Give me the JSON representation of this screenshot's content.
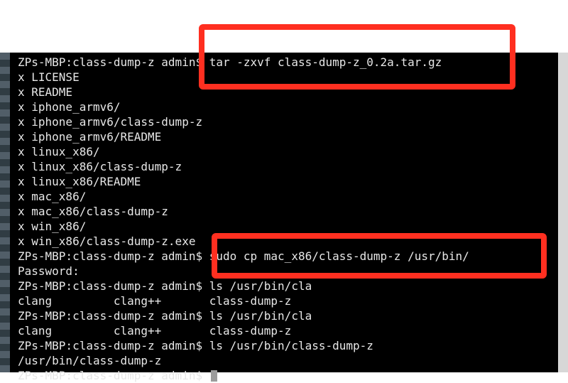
{
  "terminal": {
    "lines": [
      "ZPs-MBP:class-dump-z admin$ tar -zxvf class-dump-z_0.2a.tar.gz",
      "x LICENSE",
      "x README",
      "x iphone_armv6/",
      "x iphone_armv6/class-dump-z",
      "x iphone_armv6/README",
      "x linux_x86/",
      "x linux_x86/class-dump-z",
      "x linux_x86/README",
      "x mac_x86/",
      "x mac_x86/class-dump-z",
      "x win_x86/",
      "x win_x86/class-dump-z.exe",
      "ZPs-MBP:class-dump-z admin$ sudo cp mac_x86/class-dump-z /usr/bin/",
      "Password:",
      "ZPs-MBP:class-dump-z admin$ ls /usr/bin/cla",
      "clang         clang++       class-dump-z",
      "ZPs-MBP:class-dump-z admin$ ls /usr/bin/cla",
      "clang         clang++       class-dump-z",
      "ZPs-MBP:class-dump-z admin$ ls /usr/bin/class-dump-z",
      "/usr/bin/class-dump-z",
      "ZPs-MBP:class-dump-z admin$ "
    ]
  },
  "colors": {
    "background": "#000000",
    "text": "#e7e7e7",
    "highlight": "#ff2f20"
  }
}
